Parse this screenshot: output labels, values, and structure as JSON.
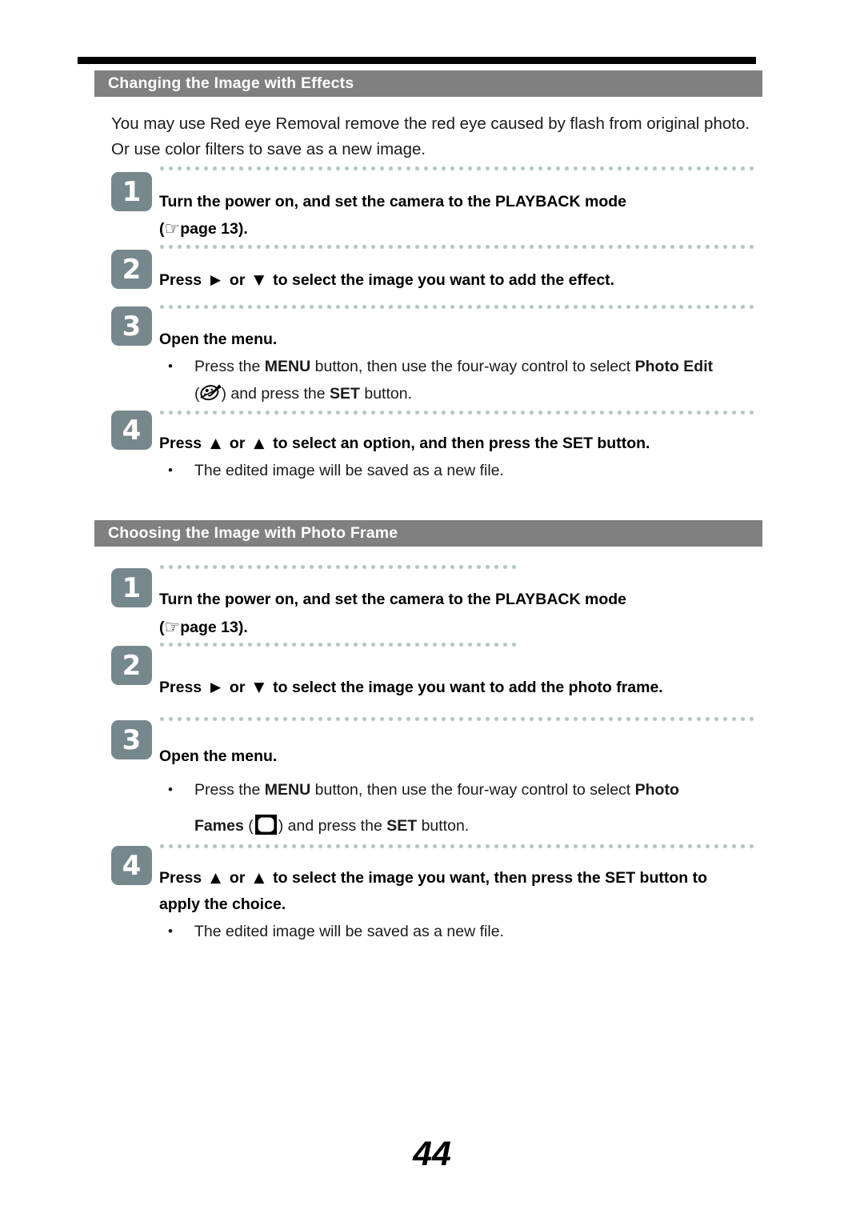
{
  "document": {
    "page_number": "44"
  },
  "sections": [
    {
      "id": "changing-image-with-effects",
      "title": "Changing the Image with Effects",
      "intro": [
        "You may use Red eye Removal remove the red eye caused by flash from original photo.",
        "Or use color filters to save as a new image."
      ],
      "steps": [
        {
          "number": "1",
          "lines": [
            "Turn the power on, and set the camera to the PLAYBACK mode",
            "page 13)."
          ],
          "hand_icon": "pointing-hand-icon"
        },
        {
          "number": "2",
          "text_before": "Press",
          "arrow1": "▶",
          "or": "or",
          "arrow2": "▼",
          "text_after": "to select the image you want to add the effect."
        },
        {
          "number": "3",
          "heading": "Open the menu.",
          "bullet": {
            "part1": "Press the",
            "menu": "MENU",
            "part2": "button, then use the four-way control to select",
            "target": "Photo Edit",
            "icon": "palette-icon",
            "part3": ") and press the",
            "set": "SET",
            "part4": "button."
          }
        },
        {
          "number": "4",
          "text_before": "Press",
          "arrow1": "▲",
          "or": "or",
          "arrow2": "▲",
          "text_after": "to select an option, and then press the SET button.",
          "bullet": "The edited image will be saved as a new file."
        }
      ]
    },
    {
      "id": "choosing-image-with-photo-frame",
      "title": "Choosing the Image with Photo Frame",
      "steps": [
        {
          "number": "1",
          "lines": [
            "Turn the power on, and set the camera to the PLAYBACK mode",
            "page 13)."
          ],
          "hand_icon": "pointing-hand-icon"
        },
        {
          "number": "2",
          "text_before": "Press",
          "arrow1": "▶",
          "or": "or",
          "arrow2": "▼",
          "text_after": "to select the image you want to add the photo frame."
        },
        {
          "number": "3",
          "heading": "Open the menu.",
          "bullet": {
            "part1": "Press the",
            "menu": "MENU",
            "part2": "button, then use the four-way control to select",
            "target": "Photo",
            "target2": "Fames",
            "icon": "photo-frame-icon",
            "part3": ") and press the",
            "set": "SET",
            "part4": "button."
          }
        },
        {
          "number": "4",
          "text_before": "Press",
          "arrow1": "▲",
          "or": "or",
          "arrow2": "▲",
          "text_after": "to select the image you want, then press the SET button to",
          "text_line2": "apply the choice.",
          "bullet": "The edited image will be saved as a new file."
        }
      ]
    }
  ],
  "colors": {
    "header_bar": "#808080",
    "top_rule": "#000000",
    "step_box": "#76888c",
    "dotted_rule": "#b5c6c6",
    "text": "#000000"
  }
}
